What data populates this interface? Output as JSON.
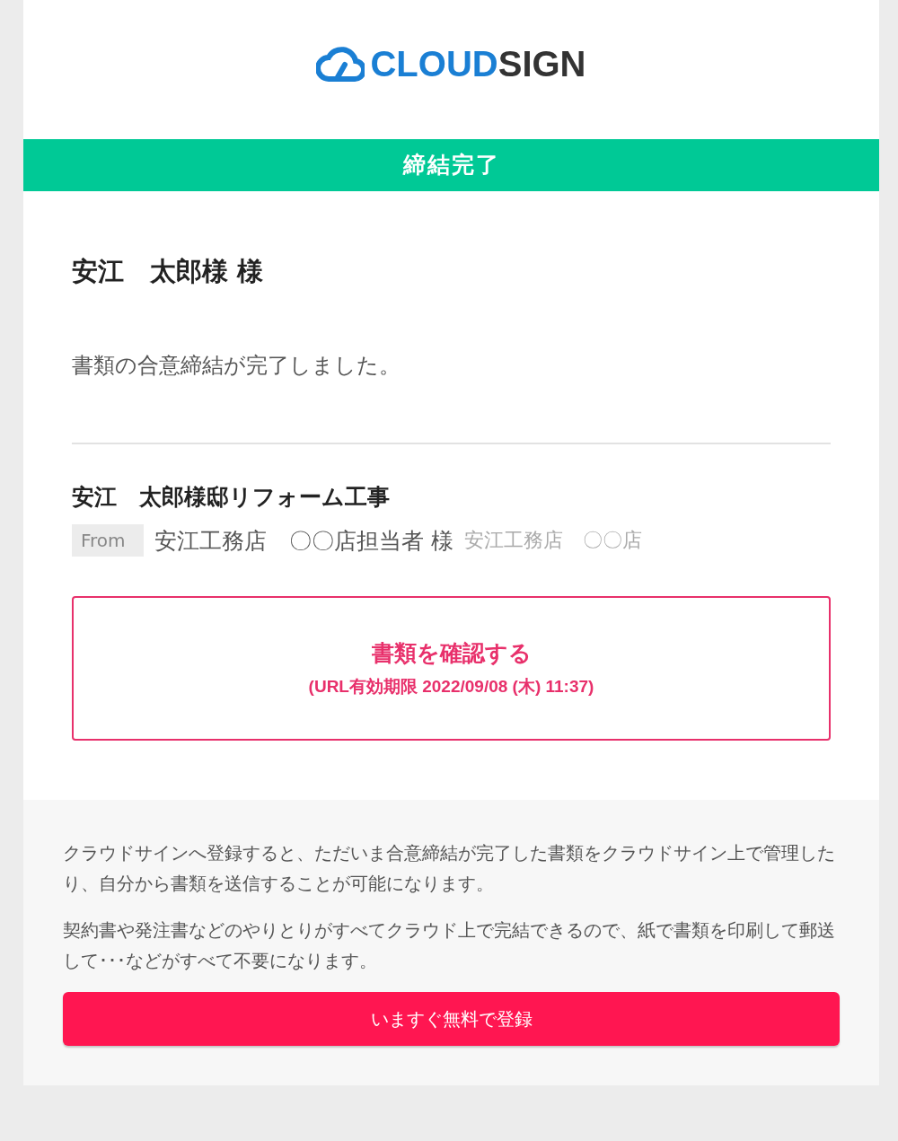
{
  "logo": {
    "primary": "CLOUD",
    "secondary": "SIGN"
  },
  "status_banner": "締結完了",
  "recipient": "安江　太郎様 様",
  "message": "書類の合意締結が完了しました。",
  "document": {
    "title": "安江　太郎様邸リフォーム工事",
    "from_label": "From",
    "sender": "安江工務店　〇〇店担当者 様",
    "sender_company": "安江工務店　〇〇店"
  },
  "view_button": {
    "label": "書類を確認する",
    "expiry": "(URL有効期限 2022/09/08 (木) 11:37)"
  },
  "promo": {
    "paragraphs": [
      "クラウドサインへ登録すると、ただいま合意締結が完了した書類をクラウドサイン上で管理したり、自分から書類を送信することが可能になります。",
      "契約書や発注書などのやりとりがすべてクラウド上で完結できるので、紙で書類を印刷して郵送して･･･などがすべて不要になります。"
    ],
    "register_button": "いますぐ無料で登録"
  }
}
